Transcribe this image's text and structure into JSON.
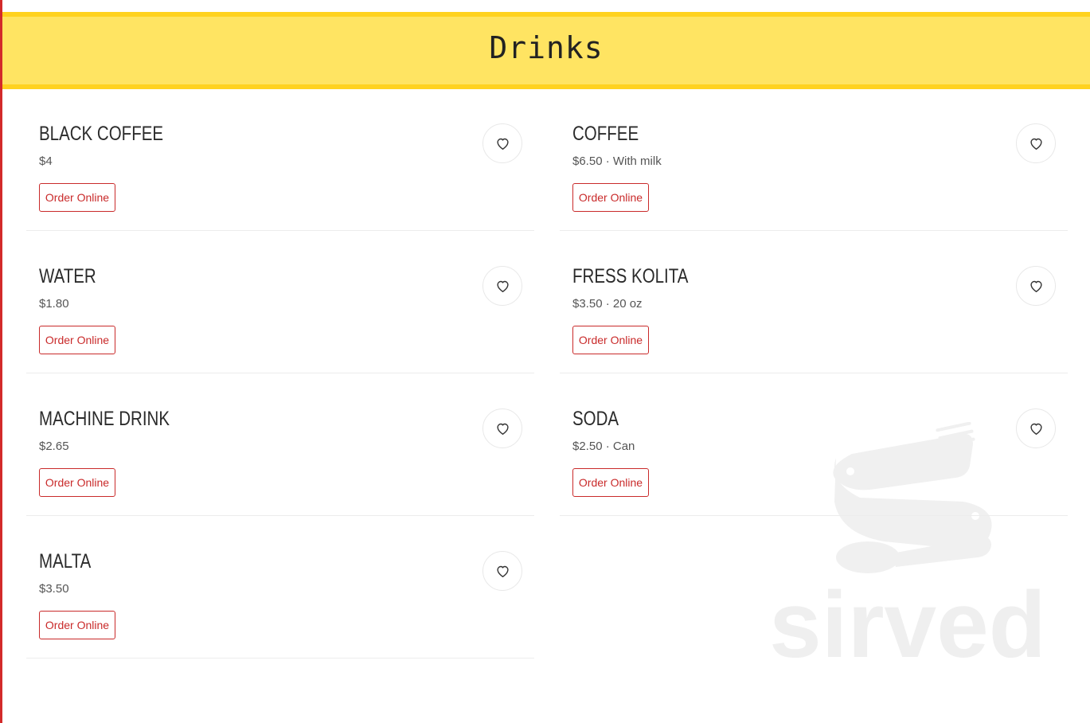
{
  "section": {
    "title": "Drinks"
  },
  "items": [
    {
      "name": "BLACK COFFEE",
      "price": "$4",
      "order_label": "Order Online",
      "favorite_icon": "heart-icon"
    },
    {
      "name": "COFFEE",
      "price": "$6.50 · With milk",
      "order_label": "Order Online",
      "favorite_icon": "heart-icon"
    },
    {
      "name": "WATER",
      "price": "$1.80",
      "order_label": "Order Online",
      "favorite_icon": "heart-icon"
    },
    {
      "name": "FRESS KOLITA",
      "price": "$3.50 · 20 oz",
      "order_label": "Order Online",
      "favorite_icon": "heart-icon"
    },
    {
      "name": "MACHINE DRINK",
      "price": "$2.65",
      "order_label": "Order Online",
      "favorite_icon": "heart-icon"
    },
    {
      "name": "SODA",
      "price": "$2.50 · Can",
      "order_label": "Order Online",
      "favorite_icon": "heart-icon"
    },
    {
      "name": "MALTA",
      "price": "$3.50",
      "order_label": "Order Online",
      "favorite_icon": "heart-icon"
    }
  ],
  "watermark": {
    "text": "sirved",
    "icon": "utensils-logo"
  },
  "colors": {
    "header_bg": "#ffe462",
    "header_border": "#ffd21f",
    "accent_red": "#c92a2a",
    "left_bar": "#d32a2a"
  }
}
